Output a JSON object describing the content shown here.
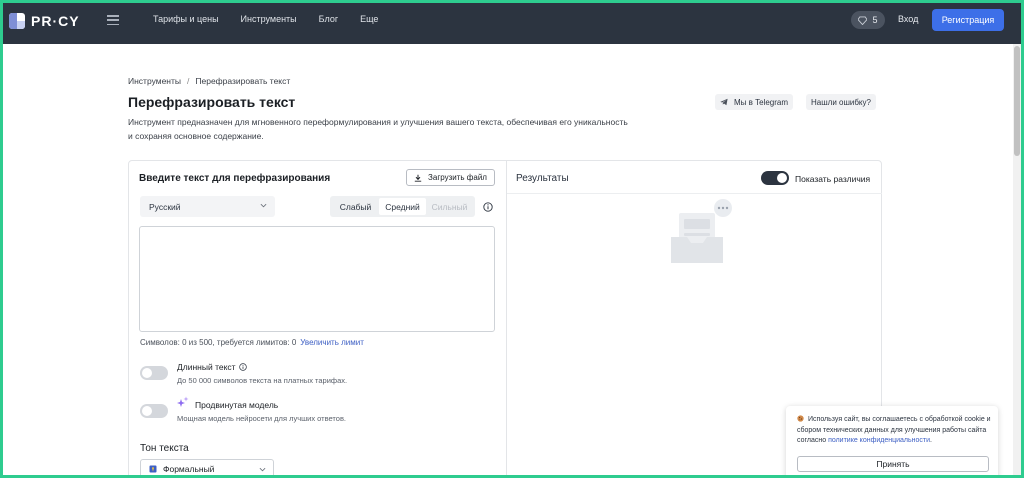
{
  "brand": {
    "name": "PR·CY"
  },
  "nav": {
    "items": [
      {
        "label": "Тарифы и цены"
      },
      {
        "label": "Инструменты"
      },
      {
        "label": "Блог"
      },
      {
        "label": "Еще"
      }
    ],
    "coins": "5",
    "login_label": "Вход",
    "register_label": "Регистрация"
  },
  "breadcrumb": {
    "root": "Инструменты",
    "separator": "/",
    "current": "Перефразировать текст"
  },
  "header": {
    "title": "Перефразировать текст",
    "description": "Инструмент предназначен для мгновенного переформулирования и улучшения вашего текста, обеспечивая его уникальность и сохраняя основное содержание.",
    "telegram_label": "Мы в Telegram",
    "report_label": "Нашли ошибку?"
  },
  "input_panel": {
    "title": "Введите текст для перефразирования",
    "upload_label": "Загрузить файл",
    "language": "Русский",
    "modes": [
      {
        "label": "Слабый",
        "state": "normal"
      },
      {
        "label": "Средний",
        "state": "active"
      },
      {
        "label": "Сильный",
        "state": "disabled"
      }
    ],
    "text_value": "",
    "char_count": "Символов: 0 из 500, требуется лимитов: 0",
    "increase_limit_label": "Увеличить лимит",
    "long_text": {
      "title": "Длинный текст",
      "subtitle": "До 50 000 символов текста на платных тарифах.",
      "enabled": false
    },
    "advanced_model": {
      "title": "Продвинутая модель",
      "subtitle": "Мощная модель нейросети для лучших ответов.",
      "enabled": false
    },
    "tone": {
      "label": "Тон текста",
      "value": "Формальный"
    }
  },
  "results_panel": {
    "title": "Результаты",
    "show_diff_label": "Показать различия",
    "show_diff_enabled": true
  },
  "cookie": {
    "text_prefix": "Используя сайт, вы соглашаетесь с обработкой cookie и сбором технических данных для улучшения работы сайта согласно",
    "link_label": "политике конфиденциальности",
    "text_suffix": ".",
    "accept_label": "Принять"
  },
  "colors": {
    "topbar": "#2c3440",
    "accent": "#3d6fe8",
    "link": "#3d5fc4",
    "frame": "#2ecc8f"
  }
}
